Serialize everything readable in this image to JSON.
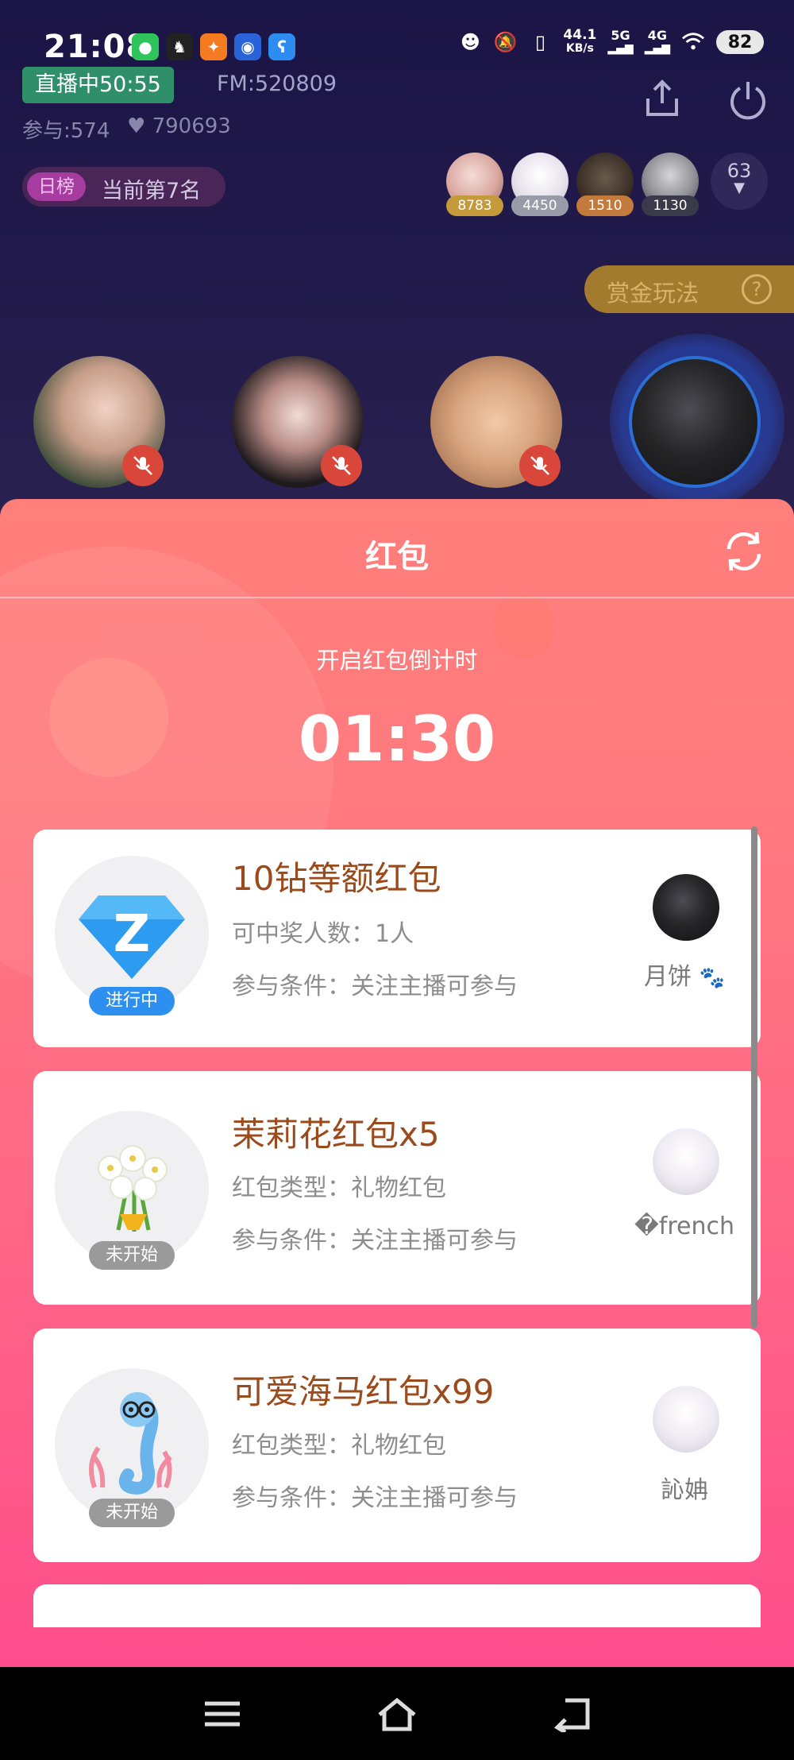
{
  "status_bar": {
    "time": "21:08",
    "speed_value": "44.1",
    "speed_unit": "KB/s",
    "net1": "5G",
    "net2": "4G",
    "battery": "82",
    "app_icons": [
      "wechat-icon",
      "app-logo-icon",
      "taobao-icon",
      "app-q-icon",
      "app-bear-icon"
    ]
  },
  "room": {
    "live_status": "直播中50:55",
    "fm_id": "FM:520809",
    "participants": "参与:574",
    "likes": "790693",
    "rank_tag": "日榜",
    "rank_text": "当前第7名",
    "top_users": [
      {
        "score": "8783",
        "badge_color": "#c49a3a"
      },
      {
        "score": "4450",
        "badge_color": "#9a9ba8"
      },
      {
        "score": "1510",
        "badge_color": "#c47a3a"
      },
      {
        "score": "1130",
        "badge_color": "#3a3a4a"
      }
    ],
    "more_count": "63",
    "bounty_label": "赏金玩法",
    "bounty_help": "?"
  },
  "panel": {
    "title": "红包",
    "countdown_label": "开启红包倒计时",
    "countdown": "01:30"
  },
  "envelopes": [
    {
      "title": "10钻等额红包",
      "line1": "可中奖人数：1人",
      "line2": "参与条件：关注主播可参与",
      "status": "进行中",
      "status_color": "#2d8ff0",
      "host": "月饼"
    },
    {
      "title": "茉莉花红包x5",
      "line1": "红包类型：礼物红包",
      "line2": "参与条件：关注主播可参与",
      "status": "未开始",
      "status_color": "#9a9a9a",
      "host": "�french"
    },
    {
      "title": "可爱海马红包x99",
      "line1": "红包类型：礼物红包",
      "line2": "参与条件：关注主播可参与",
      "status": "未开始",
      "status_color": "#9a9a9a",
      "host": "訫姌"
    }
  ]
}
